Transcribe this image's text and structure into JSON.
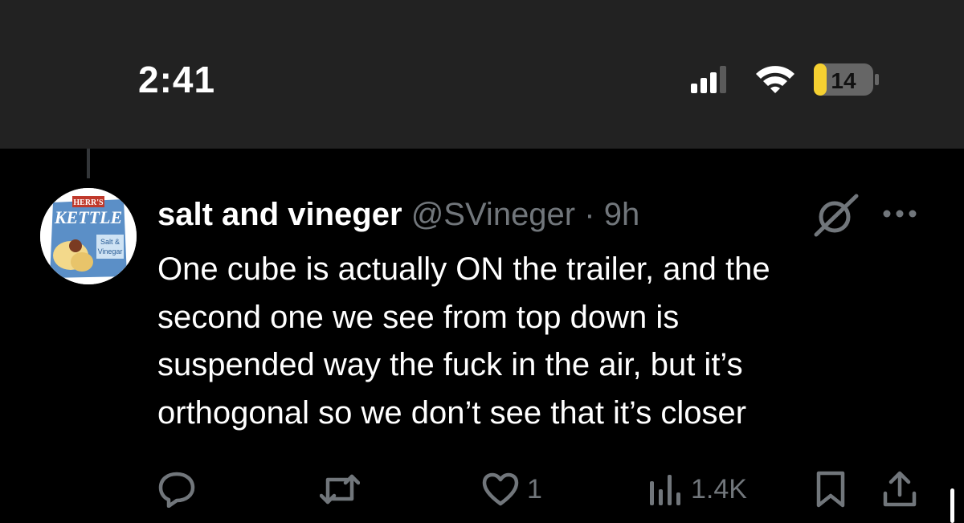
{
  "status_bar": {
    "time": "2:41",
    "battery_level": "14",
    "battery_color": "#f5d031",
    "icons": [
      "cellular-signal-icon",
      "wifi-icon",
      "battery-icon"
    ]
  },
  "tweet": {
    "avatar": {
      "brand_top": "HERR'S",
      "brand_main": "KETTLE",
      "flavor_line1": "Salt &",
      "flavor_line2": "Vinegar"
    },
    "display_name": "salt and vineger",
    "handle": "@SVineger",
    "separator": "·",
    "time_ago": "9h",
    "text_lines": [
      "One cube is actually ON the trailer, and the",
      "second one we see from top down is",
      "suspended way the fuck in the air, but it’s",
      "orthogonal so we don’t see that it’s closer"
    ],
    "header_icons": [
      "grok-icon",
      "more-options-icon"
    ]
  },
  "actions": {
    "reply_count": "",
    "repost_count": "",
    "like_count": "1",
    "views_count": "1.4K",
    "icons": [
      "reply-icon",
      "repost-icon",
      "like-icon",
      "views-icon",
      "bookmark-icon",
      "share-icon"
    ]
  }
}
